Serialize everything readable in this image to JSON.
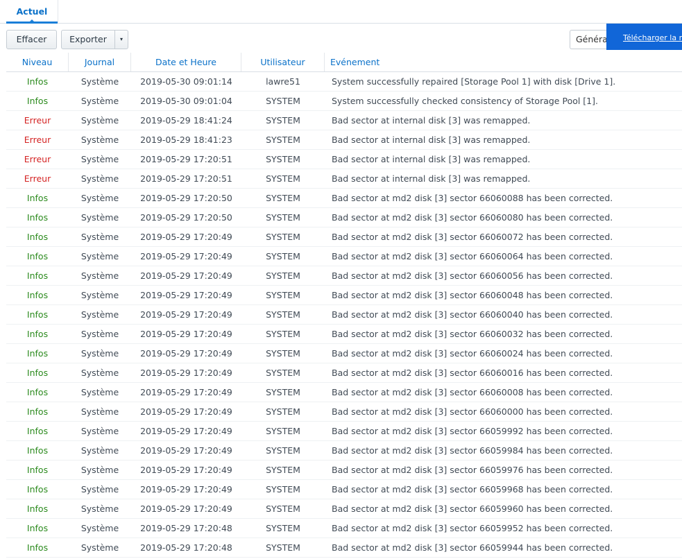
{
  "tabs": {
    "active_label": "Actuel"
  },
  "toolbar": {
    "clear_label": "Effacer",
    "export_label": "Exporter",
    "export_menu_glyph": "▾",
    "general_value": "Généra",
    "download_label": "Télécharger la m"
  },
  "colors": {
    "accent": "#0a71c9",
    "download_bg": "#1166d8",
    "info": "#2b8a1d",
    "error": "#d42323"
  },
  "table": {
    "headers": {
      "level": "Niveau",
      "journal": "Journal",
      "date": "Date et Heure",
      "user": "Utilisateur",
      "event": "Evénement"
    },
    "rows": [
      {
        "level": "Infos",
        "type": "info",
        "journal": "Système",
        "date": "2019-05-30 09:01:14",
        "user": "lawre51",
        "event": "System successfully repaired [Storage Pool 1] with disk [Drive 1]."
      },
      {
        "level": "Infos",
        "type": "info",
        "journal": "Système",
        "date": "2019-05-30 09:01:04",
        "user": "SYSTEM",
        "event": "System successfully checked consistency of Storage Pool [1]."
      },
      {
        "level": "Erreur",
        "type": "error",
        "journal": "Système",
        "date": "2019-05-29 18:41:24",
        "user": "SYSTEM",
        "event": "Bad sector at internal disk [3] was remapped."
      },
      {
        "level": "Erreur",
        "type": "error",
        "journal": "Système",
        "date": "2019-05-29 18:41:23",
        "user": "SYSTEM",
        "event": "Bad sector at internal disk [3] was remapped."
      },
      {
        "level": "Erreur",
        "type": "error",
        "journal": "Système",
        "date": "2019-05-29 17:20:51",
        "user": "SYSTEM",
        "event": "Bad sector at internal disk [3] was remapped."
      },
      {
        "level": "Erreur",
        "type": "error",
        "journal": "Système",
        "date": "2019-05-29 17:20:51",
        "user": "SYSTEM",
        "event": "Bad sector at internal disk [3] was remapped."
      },
      {
        "level": "Infos",
        "type": "info",
        "journal": "Système",
        "date": "2019-05-29 17:20:50",
        "user": "SYSTEM",
        "event": "Bad sector at md2 disk [3] sector 66060088 has been corrected."
      },
      {
        "level": "Infos",
        "type": "info",
        "journal": "Système",
        "date": "2019-05-29 17:20:50",
        "user": "SYSTEM",
        "event": "Bad sector at md2 disk [3] sector 66060080 has been corrected."
      },
      {
        "level": "Infos",
        "type": "info",
        "journal": "Système",
        "date": "2019-05-29 17:20:49",
        "user": "SYSTEM",
        "event": "Bad sector at md2 disk [3] sector 66060072 has been corrected."
      },
      {
        "level": "Infos",
        "type": "info",
        "journal": "Système",
        "date": "2019-05-29 17:20:49",
        "user": "SYSTEM",
        "event": "Bad sector at md2 disk [3] sector 66060064 has been corrected."
      },
      {
        "level": "Infos",
        "type": "info",
        "journal": "Système",
        "date": "2019-05-29 17:20:49",
        "user": "SYSTEM",
        "event": "Bad sector at md2 disk [3] sector 66060056 has been corrected."
      },
      {
        "level": "Infos",
        "type": "info",
        "journal": "Système",
        "date": "2019-05-29 17:20:49",
        "user": "SYSTEM",
        "event": "Bad sector at md2 disk [3] sector 66060048 has been corrected."
      },
      {
        "level": "Infos",
        "type": "info",
        "journal": "Système",
        "date": "2019-05-29 17:20:49",
        "user": "SYSTEM",
        "event": "Bad sector at md2 disk [3] sector 66060040 has been corrected."
      },
      {
        "level": "Infos",
        "type": "info",
        "journal": "Système",
        "date": "2019-05-29 17:20:49",
        "user": "SYSTEM",
        "event": "Bad sector at md2 disk [3] sector 66060032 has been corrected."
      },
      {
        "level": "Infos",
        "type": "info",
        "journal": "Système",
        "date": "2019-05-29 17:20:49",
        "user": "SYSTEM",
        "event": "Bad sector at md2 disk [3] sector 66060024 has been corrected."
      },
      {
        "level": "Infos",
        "type": "info",
        "journal": "Système",
        "date": "2019-05-29 17:20:49",
        "user": "SYSTEM",
        "event": "Bad sector at md2 disk [3] sector 66060016 has been corrected."
      },
      {
        "level": "Infos",
        "type": "info",
        "journal": "Système",
        "date": "2019-05-29 17:20:49",
        "user": "SYSTEM",
        "event": "Bad sector at md2 disk [3] sector 66060008 has been corrected."
      },
      {
        "level": "Infos",
        "type": "info",
        "journal": "Système",
        "date": "2019-05-29 17:20:49",
        "user": "SYSTEM",
        "event": "Bad sector at md2 disk [3] sector 66060000 has been corrected."
      },
      {
        "level": "Infos",
        "type": "info",
        "journal": "Système",
        "date": "2019-05-29 17:20:49",
        "user": "SYSTEM",
        "event": "Bad sector at md2 disk [3] sector 66059992 has been corrected."
      },
      {
        "level": "Infos",
        "type": "info",
        "journal": "Système",
        "date": "2019-05-29 17:20:49",
        "user": "SYSTEM",
        "event": "Bad sector at md2 disk [3] sector 66059984 has been corrected."
      },
      {
        "level": "Infos",
        "type": "info",
        "journal": "Système",
        "date": "2019-05-29 17:20:49",
        "user": "SYSTEM",
        "event": "Bad sector at md2 disk [3] sector 66059976 has been corrected."
      },
      {
        "level": "Infos",
        "type": "info",
        "journal": "Système",
        "date": "2019-05-29 17:20:49",
        "user": "SYSTEM",
        "event": "Bad sector at md2 disk [3] sector 66059968 has been corrected."
      },
      {
        "level": "Infos",
        "type": "info",
        "journal": "Système",
        "date": "2019-05-29 17:20:49",
        "user": "SYSTEM",
        "event": "Bad sector at md2 disk [3] sector 66059960 has been corrected."
      },
      {
        "level": "Infos",
        "type": "info",
        "journal": "Système",
        "date": "2019-05-29 17:20:48",
        "user": "SYSTEM",
        "event": "Bad sector at md2 disk [3] sector 66059952 has been corrected."
      },
      {
        "level": "Infos",
        "type": "info",
        "journal": "Système",
        "date": "2019-05-29 17:20:48",
        "user": "SYSTEM",
        "event": "Bad sector at md2 disk [3] sector 66059944 has been corrected."
      }
    ]
  }
}
